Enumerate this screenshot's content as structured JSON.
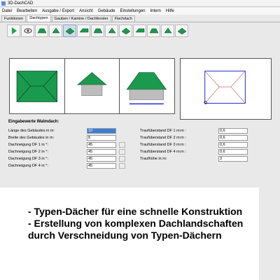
{
  "window": {
    "title": "3D-DachCAD"
  },
  "menu": [
    "Datei",
    "Bearbeiten",
    "Ausgabe / Export",
    "Ansicht",
    "Gebäude",
    "Einstellungen",
    "Intern",
    "Hilfe"
  ],
  "tabs": [
    "Funktionen",
    "Dachtypen",
    "Gauben / Kamine / Dachfenster",
    "Flachdach"
  ],
  "active_tab": 1,
  "toolbar": {
    "items": [
      "play-icon",
      "eye-icon",
      "roof-type-1-icon",
      "roof-type-2-icon",
      "roof-type-3-icon",
      "roof-type-4-icon",
      "roof-type-5-icon",
      "roof-type-6-icon",
      "roof-type-7-icon",
      "roof-type-8-icon",
      "roof-type-9-icon",
      "roof-type-10-icon",
      "roof-type-11-icon"
    ],
    "selected": 4
  },
  "colors": {
    "roof": "#1a9a4e",
    "wall": "#bdbdbd",
    "eave_line": "#1b2bd6",
    "field_focus": "#3b7fd6"
  },
  "form": {
    "title": "Eingabewerte Walmdach:",
    "left": [
      {
        "label": "Länge des Gebäudes in m:",
        "value": "10"
      },
      {
        "label": "Breite des Gebäudes in m:",
        "value": "8"
      },
      {
        "label": "Dachneigung DF 1 in °:",
        "value": "45"
      },
      {
        "label": "Dachneigung DF 2 in °:",
        "value": "45"
      },
      {
        "label": "Dachneigung DF 3 in °:",
        "value": "45"
      },
      {
        "label": "Dachneigung DF 4 in °:",
        "value": "45"
      }
    ],
    "right": [
      {
        "label": "Traufüberstand DF 1 m:m :",
        "value": "0,6"
      },
      {
        "label": "Traufüberstand DF 2 m:m :",
        "value": "0,6"
      },
      {
        "label": "Traufüberstand DF 3 m:m :",
        "value": "0,6"
      },
      {
        "label": "Traufüberstand DF 4 m:m :",
        "value": "0,6"
      },
      {
        "label": "Traufhöhe in m:",
        "value": "3"
      }
    ]
  },
  "caption": [
    "- Typen-Dächer für eine schnelle Konstruktion",
    "- Erstellung von komplexen Dachlandschaften",
    "  durch Verschneidung von Typen-Dächern"
  ]
}
